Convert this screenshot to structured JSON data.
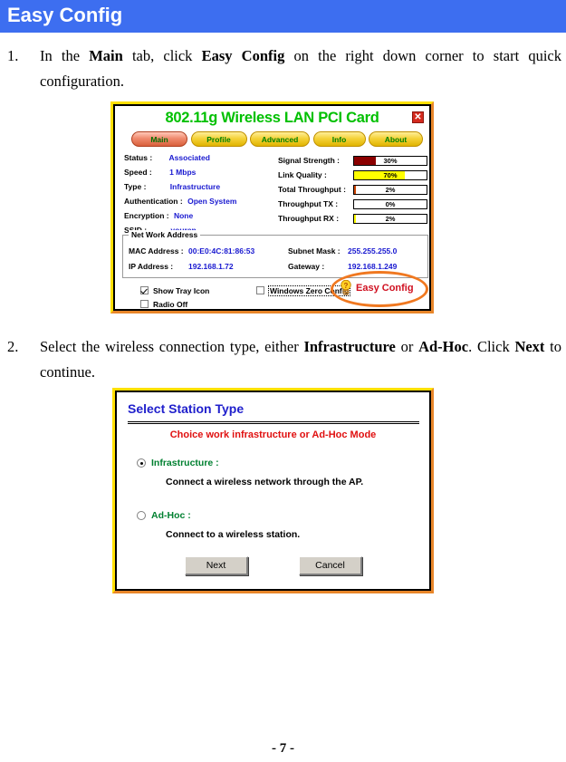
{
  "header": {
    "title": "Easy Config",
    "background_color": "#3d6ef0",
    "text_color": "#ffffff"
  },
  "steps": [
    {
      "number": "1.",
      "segments": [
        {
          "text": "In the ",
          "bold": false
        },
        {
          "text": "Main",
          "bold": true
        },
        {
          "text": " tab, click ",
          "bold": false
        },
        {
          "text": "Easy Config",
          "bold": true
        },
        {
          "text": " on the right down corner to start quick configuration.",
          "bold": false
        }
      ]
    },
    {
      "number": "2.",
      "segments": [
        {
          "text": "Select the wireless connection type, either ",
          "bold": false
        },
        {
          "text": "Infrastructure",
          "bold": true
        },
        {
          "text": " or ",
          "bold": false
        },
        {
          "text": "Ad-Hoc",
          "bold": true
        },
        {
          "text": ". Click ",
          "bold": false
        },
        {
          "text": "Next",
          "bold": true
        },
        {
          "text": " to continue.",
          "bold": false
        }
      ]
    }
  ],
  "figure_wireless_utility": {
    "window_title": "802.11g Wireless LAN PCI Card",
    "title_color": "#00c000",
    "close_label": "✕",
    "tabs": [
      {
        "label": "Main",
        "active": true
      },
      {
        "label": "Profile",
        "active": false
      },
      {
        "label": "Advanced",
        "active": false
      },
      {
        "label": "Info",
        "active": false
      },
      {
        "label": "About",
        "active": false
      }
    ],
    "status_fields": [
      {
        "label": "Status :",
        "value": "Associated"
      },
      {
        "label": "Speed :",
        "value": "1 Mbps"
      },
      {
        "label": "Type :",
        "value": "Infrastructure"
      },
      {
        "label": "Authentication :",
        "value": "Open System"
      },
      {
        "label": "Encryption :",
        "value": "None"
      },
      {
        "label": "SSID :",
        "value": "youren"
      }
    ],
    "meters": [
      {
        "label": "Signal Strength :",
        "value": "30%",
        "percent": 30,
        "fill_color": "#8b0000"
      },
      {
        "label": "Link Quality :",
        "value": "70%",
        "percent": 70,
        "fill_color": "#ffff00"
      },
      {
        "label": "Total Throughput :",
        "value": "2%",
        "percent": 2,
        "fill_color": "#cc4400"
      },
      {
        "label": "Throughput TX :",
        "value": "0%",
        "percent": 0,
        "fill_color": "#cc4400"
      },
      {
        "label": "Throughput RX :",
        "value": "2%",
        "percent": 2,
        "fill_color": "#ffff00"
      }
    ],
    "network_group_label": "Net Work Address",
    "network_fields": [
      {
        "label": "MAC Address :",
        "value": "00:E0:4C:81:86:53"
      },
      {
        "label": "Subnet Mask :",
        "value": "255.255.255.0"
      },
      {
        "label": "IP Address :",
        "value": "192.168.1.72"
      },
      {
        "label": "Gateway :",
        "value": "192.168.1.249"
      }
    ],
    "checkboxes": [
      {
        "label": "Show Tray Icon",
        "checked": true
      },
      {
        "label": "Radio Off",
        "checked": false
      },
      {
        "label": "Windows Zero Config",
        "checked": false
      }
    ],
    "easy_config": {
      "label": "Easy Config",
      "text_color": "#d01020",
      "icon": "lightbulb-question-icon",
      "annotation_color": "#f07820"
    }
  },
  "figure_station_type": {
    "title": "Select Station Type",
    "title_color": "#2020cc",
    "subtitle": "Choice work infrastructure  or Ad-Hoc Mode",
    "subtitle_color": "#e01010",
    "options": [
      {
        "label": "Infrastructure :",
        "description": "Connect a wireless network through the AP.",
        "selected": true
      },
      {
        "label": "Ad-Hoc :",
        "description": "Connect to a wireless station.",
        "selected": false
      }
    ],
    "buttons": [
      {
        "label": "Next"
      },
      {
        "label": "Cancel"
      }
    ]
  },
  "footer": {
    "page_number": "- 7 -"
  }
}
